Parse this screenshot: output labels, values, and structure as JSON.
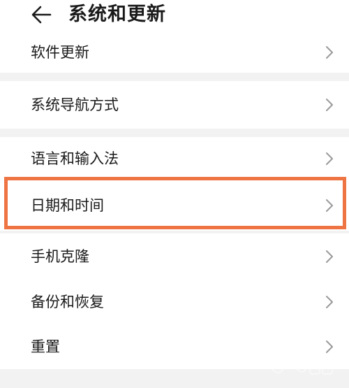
{
  "header": {
    "back_icon": "arrow-left-icon",
    "title": "系统和更新"
  },
  "groups": [
    {
      "items": [
        {
          "label": "软件更新"
        }
      ]
    },
    {
      "items": [
        {
          "label": "系统导航方式"
        }
      ]
    },
    {
      "items": [
        {
          "label": "语言和输入法"
        },
        {
          "label": "日期和时间",
          "highlighted": true
        }
      ]
    },
    {
      "items": [
        {
          "label": "手机克隆"
        },
        {
          "label": "备份和恢复"
        },
        {
          "label": "重置"
        }
      ]
    }
  ],
  "colors": {
    "highlight": "#ef7443",
    "background": "#f2f2f2",
    "card": "#ffffff",
    "chevron": "#9a9a9a"
  },
  "watermark": {
    "icon": "baidu-jingyan-logo"
  }
}
